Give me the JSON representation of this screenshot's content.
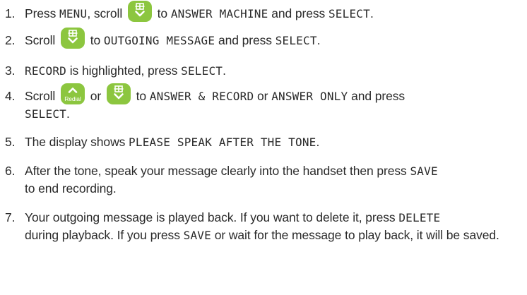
{
  "icons": {
    "scroll_down": "phonebook-scroll-down-icon",
    "scroll_up": "redial-scroll-up-icon",
    "key_color": "#8cc63f"
  },
  "steps": [
    {
      "num": "1.",
      "a": "Press ",
      "b": "MENU",
      "c": ", scroll",
      "d": "to",
      "e": "ANSWER MACHINE",
      "f": "and press",
      "g": "SELECT",
      "h": "."
    },
    {
      "num": "2.",
      "a": "Scroll",
      "b": "to",
      "c": "OUTGOING MESSAGE",
      "d": "and press",
      "e": "SELECT",
      "f": "."
    },
    {
      "num": "3.",
      "a": "RECORD",
      "b": " is highlighted, press ",
      "c": "SELECT",
      "d": "."
    },
    {
      "num": "4.",
      "a": "Scroll",
      "redial_label": "Redial",
      "b": "or",
      "c": "to",
      "d": "ANSWER & RECORD",
      "e": "or",
      "f": "ANSWER ONLY",
      "g": "and press",
      "h": "SELECT",
      "i": "."
    },
    {
      "num": "5.",
      "a": "The display shows ",
      "b": "PLEASE SPEAK AFTER THE TONE",
      "c": "."
    },
    {
      "num": "6.",
      "a": "After the tone, speak your message clearly into the handset then press ",
      "b": "SAVE",
      "c": "to end recording."
    },
    {
      "num": "7.",
      "a": "Your outgoing message is played back. If you want to delete it, press ",
      "b": "DELETE",
      "c": "during playback. If you press ",
      "d": "SAVE",
      "e": " or wait for the message to play back, it will be saved."
    }
  ]
}
